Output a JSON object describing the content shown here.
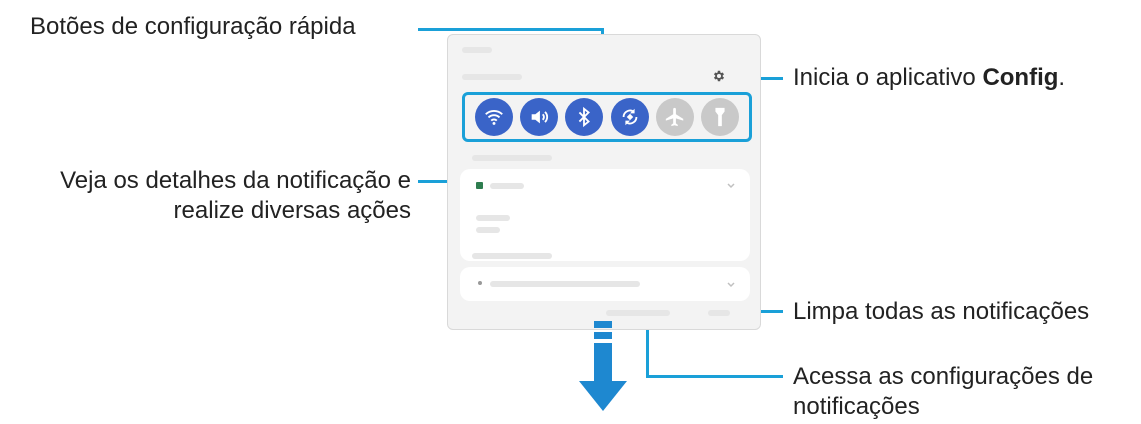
{
  "callouts": {
    "quick_settings": "Botões de configuração rápida",
    "settings_app_prefix": "Inicia o aplicativo ",
    "settings_app_bold": "Config",
    "settings_app_suffix": ".",
    "notification_details_line1": "Veja os detalhes da notificação e",
    "notification_details_line2": "realize diversas ações",
    "clear_all": "Limpa todas as notificações",
    "notification_settings_line1": "Acessa as configurações de",
    "notification_settings_line2": "notificações"
  },
  "panel": {
    "quick_buttons": [
      {
        "icon": "wifi-icon",
        "state": "on"
      },
      {
        "icon": "sound-icon",
        "state": "on"
      },
      {
        "icon": "bluetooth-icon",
        "state": "on"
      },
      {
        "icon": "auto-rotate-icon",
        "state": "on"
      },
      {
        "icon": "airplane-icon",
        "state": "off"
      },
      {
        "icon": "flashlight-icon",
        "state": "off"
      }
    ]
  },
  "colors": {
    "callout_line": "#1aa0d8",
    "quick_button_on": "#3a64c8",
    "quick_button_off": "#c9c9c9",
    "arrow": "#1e88d0"
  }
}
